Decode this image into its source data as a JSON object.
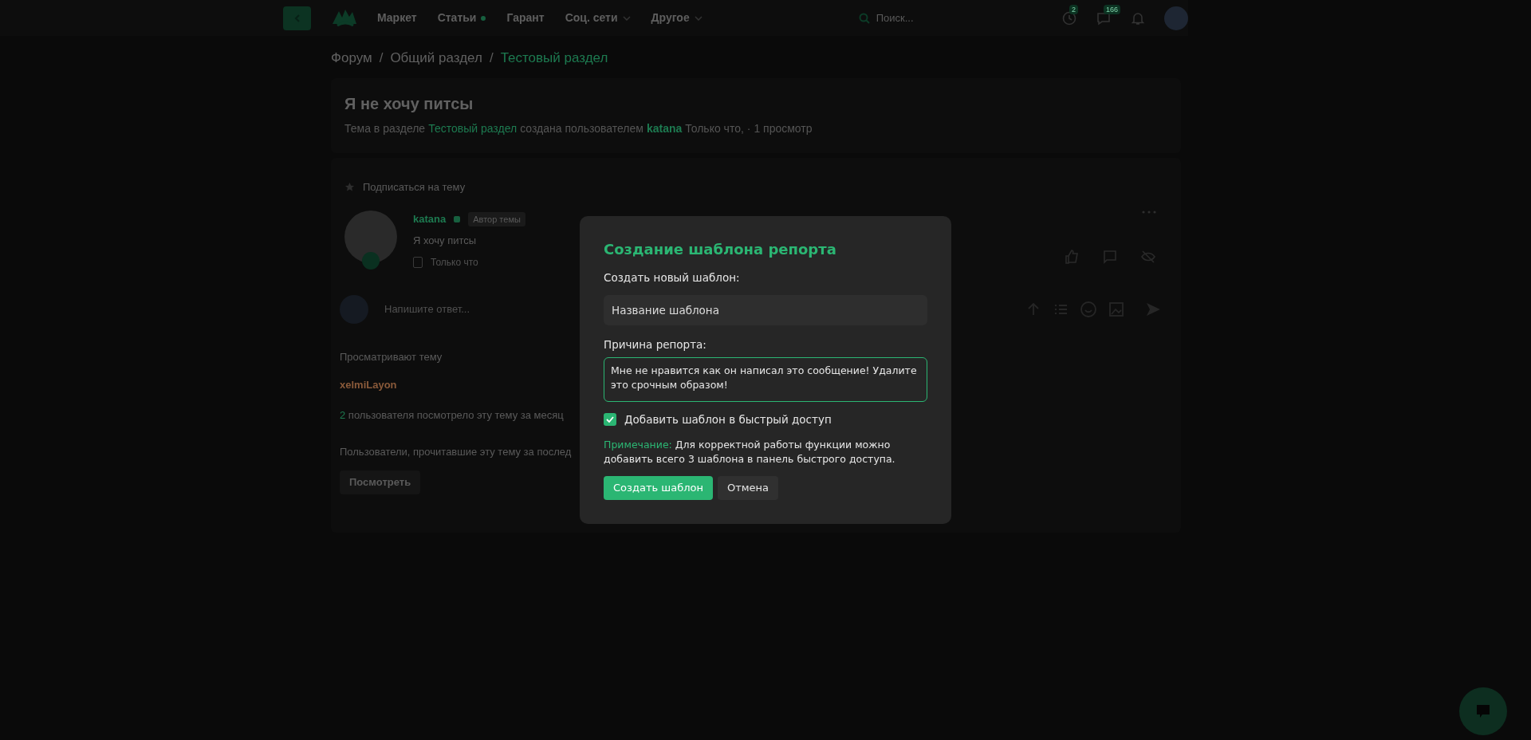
{
  "navbar": {
    "menu": [
      {
        "label": "Маркет",
        "dropdown": false,
        "new_dot": false
      },
      {
        "label": "Статьи",
        "dropdown": false,
        "new_dot": true
      },
      {
        "label": "Гарант",
        "dropdown": false,
        "new_dot": false
      },
      {
        "label": "Соц. сети",
        "dropdown": true,
        "new_dot": false
      },
      {
        "label": "Другое",
        "dropdown": true,
        "new_dot": false
      }
    ],
    "search": {
      "placeholder": "Поиск..."
    },
    "icons": [
      {
        "kind": "clock",
        "badge": "2"
      },
      {
        "kind": "chat",
        "badge": "166"
      },
      {
        "kind": "bell"
      }
    ]
  },
  "breadcrumb_separator": "/",
  "breadcrumbs": [
    {
      "label": "Форум",
      "current": false
    },
    {
      "label": "Общий раздел",
      "current": false
    },
    {
      "label": "Тестовый раздел",
      "current": true
    }
  ],
  "thread": {
    "title": "Я не хочу питсы",
    "meta": [
      {
        "kind": "text",
        "text": "Тема в разделе"
      },
      {
        "kind": "link",
        "text": "Тестовый раздел"
      },
      {
        "kind": "text",
        "text": "создана пользователем"
      },
      {
        "kind": "user",
        "text": "katana"
      },
      {
        "kind": "text",
        "text": "Только что,"
      },
      {
        "kind": "text",
        "text": "· 1 просмотр"
      }
    ]
  },
  "subscribe": {
    "label": "Подписаться на тему"
  },
  "post": {
    "author": "katana",
    "online": true,
    "author_badge": "Автор темы",
    "text": "Я хочу питсы",
    "time": "Только что",
    "selected": false
  },
  "reply": {
    "placeholder": "Напишите ответ..."
  },
  "viewers": {
    "title": "Просматривают тему",
    "users": [
      "xelmiLayon"
    ],
    "month_count": "2",
    "month_text": "пользователя посмотрело эту тему за месяц",
    "readers_text": "Пользователи, прочитавшие эту тему за послед",
    "view_button": "Посмотреть"
  },
  "modal": {
    "title": "Создание шаблона репорта",
    "name_label": "Создать новый шаблон:",
    "name_placeholder": "Название шаблона",
    "reason_label": "Причина репорта:",
    "reason_value": "Мне не нравится как он написал это сообщение! Удалите это срочным образом!",
    "quick_access": {
      "label": "Добавить шаблон в быстрый доступ",
      "checked": true
    },
    "note_label": "Примечание:",
    "note_text": "Для корректной работы функции можно добавить всего 3 шаблона в панель быстрого доступа.",
    "buttons": [
      {
        "label": "Создать шаблон",
        "kind": "primary"
      },
      {
        "label": "Отмена",
        "kind": "secondary"
      }
    ]
  }
}
